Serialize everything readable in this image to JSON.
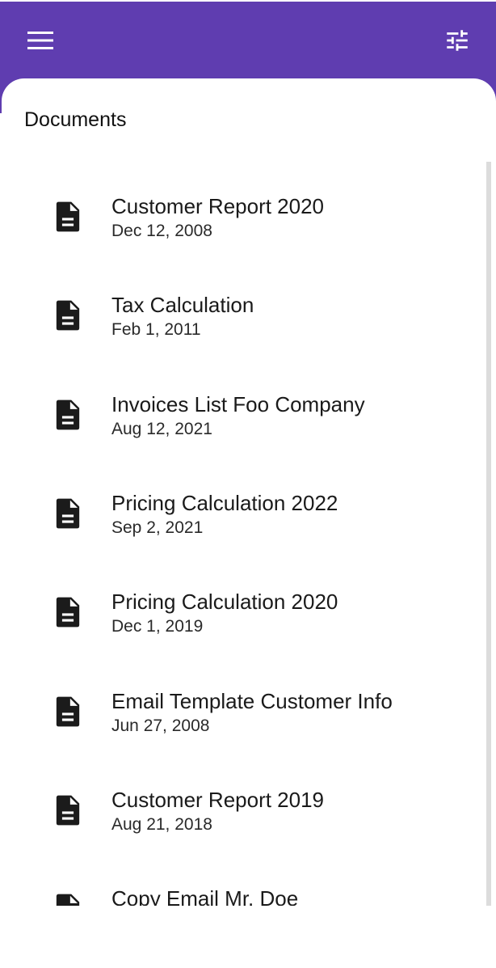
{
  "header": {
    "menu_icon": "hamburger-menu-icon",
    "filter_icon": "tune-sliders-icon",
    "bar_color": "#5f3db0"
  },
  "page": {
    "title": "Documents"
  },
  "documents": [
    {
      "name": "Customer Report 2020",
      "date": "Dec 12, 2008",
      "icon": "document-icon"
    },
    {
      "name": "Tax Calculation",
      "date": "Feb 1, 2011",
      "icon": "document-icon"
    },
    {
      "name": "Invoices List Foo Company",
      "date": "Aug 12, 2021",
      "icon": "document-icon"
    },
    {
      "name": "Pricing Calculation 2022",
      "date": "Sep 2, 2021",
      "icon": "document-icon"
    },
    {
      "name": "Pricing Calculation 2020",
      "date": "Dec 1, 2019",
      "icon": "document-icon"
    },
    {
      "name": "Email Template Customer Info",
      "date": "Jun 27, 2008",
      "icon": "document-icon"
    },
    {
      "name": "Customer Report 2019",
      "date": "Aug 21, 2018",
      "icon": "document-icon"
    },
    {
      "name": "Copy Email Mr. Doe",
      "date": "",
      "icon": "document-icon"
    }
  ]
}
